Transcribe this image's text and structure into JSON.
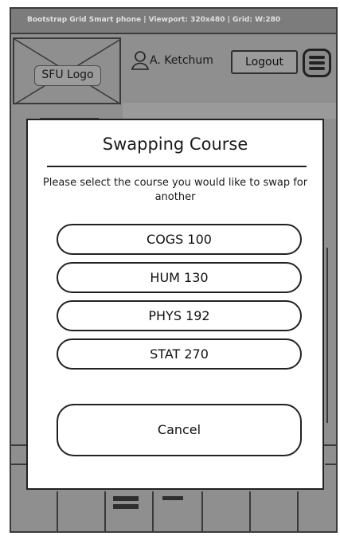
{
  "topbar": {
    "text": "Bootstrap Grid Smart phone  |  Viewport: 320x480  |  Grid: W:280"
  },
  "header": {
    "logo_label": "SFU Logo",
    "user_name": "A. Ketchum",
    "logout_label": "Logout"
  },
  "modal": {
    "title": "Swapping Course",
    "message": "Please select the course you would like to swap for another",
    "courses": [
      {
        "label": "COGS 100"
      },
      {
        "label": "HUM 130"
      },
      {
        "label": "PHYS 192"
      },
      {
        "label": "STAT 270"
      }
    ],
    "cancel_label": "Cancel"
  }
}
